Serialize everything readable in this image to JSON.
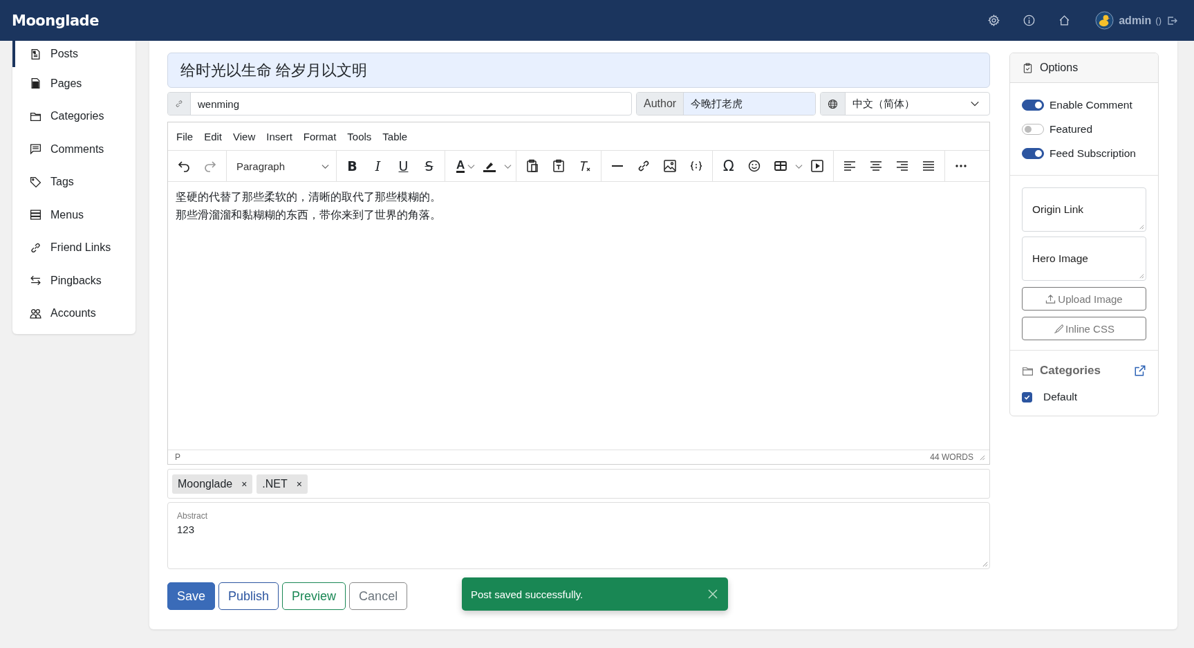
{
  "header": {
    "brand": "Moonglade",
    "user": "admin",
    "user_suffix": "()"
  },
  "sidebar": {
    "items": [
      {
        "label": "Posts",
        "selected": true
      },
      {
        "label": "Pages",
        "selected": false
      },
      {
        "label": "Categories",
        "selected": false
      },
      {
        "label": "Comments",
        "selected": false
      },
      {
        "label": "Tags",
        "selected": false
      },
      {
        "label": "Menus",
        "selected": false
      },
      {
        "label": "Friend Links",
        "selected": false
      },
      {
        "label": "Pingbacks",
        "selected": false
      },
      {
        "label": "Accounts",
        "selected": false
      }
    ]
  },
  "post": {
    "title": "给时光以生命 给岁月以文明",
    "slug": "wenming",
    "author_label": "Author",
    "author": "今晚打老虎",
    "language": "中文（简体）"
  },
  "editor": {
    "menu": [
      "File",
      "Edit",
      "View",
      "Insert",
      "Format",
      "Tools",
      "Table"
    ],
    "block_format": "Paragraph",
    "format_buttons": [
      {
        "kind": "bold",
        "label": "B"
      },
      {
        "kind": "italic",
        "label": "I"
      },
      {
        "kind": "underline",
        "label": "U"
      },
      {
        "kind": "strike",
        "label": "S"
      }
    ],
    "text_color_label": "A",
    "special_char_label": "Ω",
    "content": [
      "坚硬的代替了那些柔软的，清晰的取代了那些模糊的。",
      "那些滑溜溜和黏糊糊的东西，带你来到了世界的角落。"
    ],
    "status_path": "P",
    "word_count": "44 WORDS"
  },
  "tags": [
    {
      "label": "Moonglade",
      "remove": "×"
    },
    {
      "label": ".NET",
      "remove": "×"
    }
  ],
  "abstract": {
    "label": "Abstract",
    "value": "123"
  },
  "actions": [
    {
      "label": "Save",
      "kind": "primary"
    },
    {
      "label": "Publish",
      "kind": "outline-primary"
    },
    {
      "label": "Preview",
      "kind": "outline-success"
    },
    {
      "label": "Cancel",
      "kind": "outline-secondary"
    }
  ],
  "options": {
    "title": "Options",
    "toggles": [
      {
        "label": "Enable Comment",
        "on": true
      },
      {
        "label": "Featured",
        "on": false
      },
      {
        "label": "Feed Subscription",
        "on": true
      }
    ],
    "origin_link": {
      "placeholder": "Origin Link"
    },
    "hero_image": {
      "placeholder": "Hero Image"
    },
    "upload_button": "Upload Image",
    "css_button": "Inline CSS",
    "categories_title": "Categories",
    "categories": [
      {
        "label": "Default",
        "checked": true
      }
    ]
  },
  "toast": {
    "message": "Post saved successfully."
  }
}
